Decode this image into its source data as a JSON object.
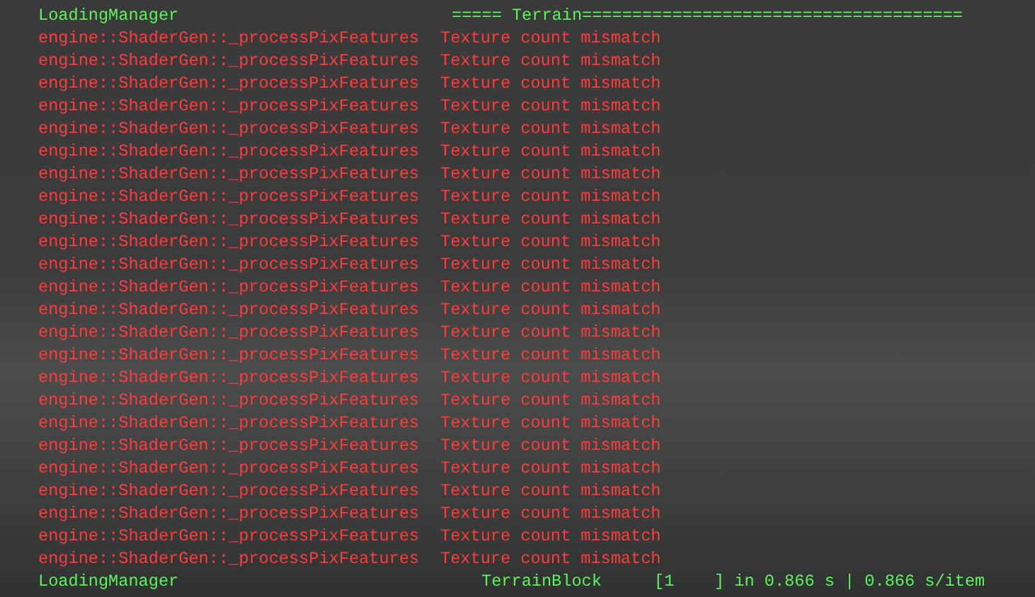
{
  "header": {
    "source": "LoadingManager",
    "section": "===== Terrain",
    "rule": "======================================"
  },
  "lines": [
    {
      "kind": "error",
      "source": "engine::ShaderGen::_processPixFeatures",
      "message": "Texture count mismatch"
    },
    {
      "kind": "error",
      "source": "engine::ShaderGen::_processPixFeatures",
      "message": "Texture count mismatch"
    },
    {
      "kind": "error",
      "source": "engine::ShaderGen::_processPixFeatures",
      "message": "Texture count mismatch"
    },
    {
      "kind": "error",
      "source": "engine::ShaderGen::_processPixFeatures",
      "message": "Texture count mismatch"
    },
    {
      "kind": "error",
      "source": "engine::ShaderGen::_processPixFeatures",
      "message": "Texture count mismatch"
    },
    {
      "kind": "error",
      "source": "engine::ShaderGen::_processPixFeatures",
      "message": "Texture count mismatch"
    },
    {
      "kind": "error",
      "source": "engine::ShaderGen::_processPixFeatures",
      "message": "Texture count mismatch"
    },
    {
      "kind": "error",
      "source": "engine::ShaderGen::_processPixFeatures",
      "message": "Texture count mismatch"
    },
    {
      "kind": "error",
      "source": "engine::ShaderGen::_processPixFeatures",
      "message": "Texture count mismatch"
    },
    {
      "kind": "error",
      "source": "engine::ShaderGen::_processPixFeatures",
      "message": "Texture count mismatch"
    },
    {
      "kind": "error",
      "source": "engine::ShaderGen::_processPixFeatures",
      "message": "Texture count mismatch"
    },
    {
      "kind": "error",
      "source": "engine::ShaderGen::_processPixFeatures",
      "message": "Texture count mismatch"
    },
    {
      "kind": "error",
      "source": "engine::ShaderGen::_processPixFeatures",
      "message": "Texture count mismatch"
    },
    {
      "kind": "error",
      "source": "engine::ShaderGen::_processPixFeatures",
      "message": "Texture count mismatch"
    },
    {
      "kind": "error",
      "source": "engine::ShaderGen::_processPixFeatures",
      "message": "Texture count mismatch"
    },
    {
      "kind": "error",
      "source": "engine::ShaderGen::_processPixFeatures",
      "message": "Texture count mismatch"
    },
    {
      "kind": "error",
      "source": "engine::ShaderGen::_processPixFeatures",
      "message": "Texture count mismatch"
    },
    {
      "kind": "error",
      "source": "engine::ShaderGen::_processPixFeatures",
      "message": "Texture count mismatch"
    },
    {
      "kind": "error",
      "source": "engine::ShaderGen::_processPixFeatures",
      "message": "Texture count mismatch"
    },
    {
      "kind": "error",
      "source": "engine::ShaderGen::_processPixFeatures",
      "message": "Texture count mismatch"
    },
    {
      "kind": "error",
      "source": "engine::ShaderGen::_processPixFeatures",
      "message": "Texture count mismatch"
    },
    {
      "kind": "error",
      "source": "engine::ShaderGen::_processPixFeatures",
      "message": "Texture count mismatch"
    },
    {
      "kind": "error",
      "source": "engine::ShaderGen::_processPixFeatures",
      "message": "Texture count mismatch"
    },
    {
      "kind": "error",
      "source": "engine::ShaderGen::_processPixFeatures",
      "message": "Texture count mismatch"
    }
  ],
  "footer": {
    "source": "LoadingManager",
    "task": "TerrainBlock",
    "progress": "[1    ] in 0.866 s | 0.866 s/item"
  }
}
